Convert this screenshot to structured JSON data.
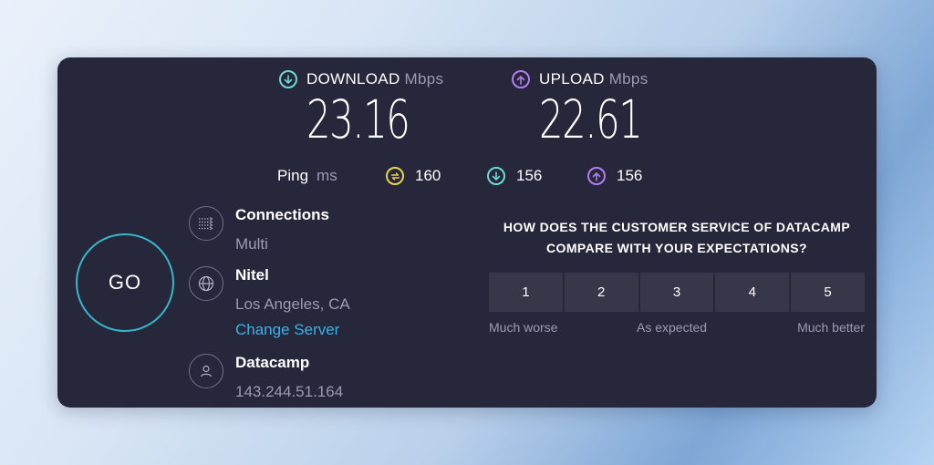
{
  "download": {
    "label": "DOWNLOAD",
    "unit": "Mbps",
    "value": "23.16",
    "icon": "arrow-down-circle-icon",
    "color": "#6fd9d3"
  },
  "upload": {
    "label": "UPLOAD",
    "unit": "Mbps",
    "value": "22.61",
    "icon": "arrow-up-circle-icon",
    "color": "#b17ef0"
  },
  "ping": {
    "label": "Ping",
    "unit": "ms",
    "idle": {
      "value": "160",
      "icon": "idle-latency-icon",
      "color": "#e8d44d"
    },
    "down": {
      "value": "156",
      "icon": "arrow-down-circle-icon",
      "color": "#6fd9d3"
    },
    "up": {
      "value": "156",
      "icon": "arrow-up-circle-icon",
      "color": "#b17ef0"
    }
  },
  "go_button": {
    "label": "GO",
    "color": "#36b8cc"
  },
  "connections": {
    "title": "Connections",
    "value": "Multi",
    "icon": "connections-icon"
  },
  "server": {
    "title": "Nitel",
    "location": "Los Angeles, CA",
    "change_link": "Change Server",
    "icon": "globe-icon",
    "link_color": "#35b3ea"
  },
  "provider": {
    "title": "Datacamp",
    "ip": "143.244.51.164",
    "icon": "user-icon"
  },
  "survey": {
    "question_line1": "HOW DOES THE CUSTOMER SERVICE OF DATACAMP",
    "question_line2": "COMPARE WITH YOUR EXPECTATIONS?",
    "options": [
      "1",
      "2",
      "3",
      "4",
      "5"
    ],
    "label_low": "Much worse",
    "label_mid": "As expected",
    "label_high": "Much better"
  }
}
